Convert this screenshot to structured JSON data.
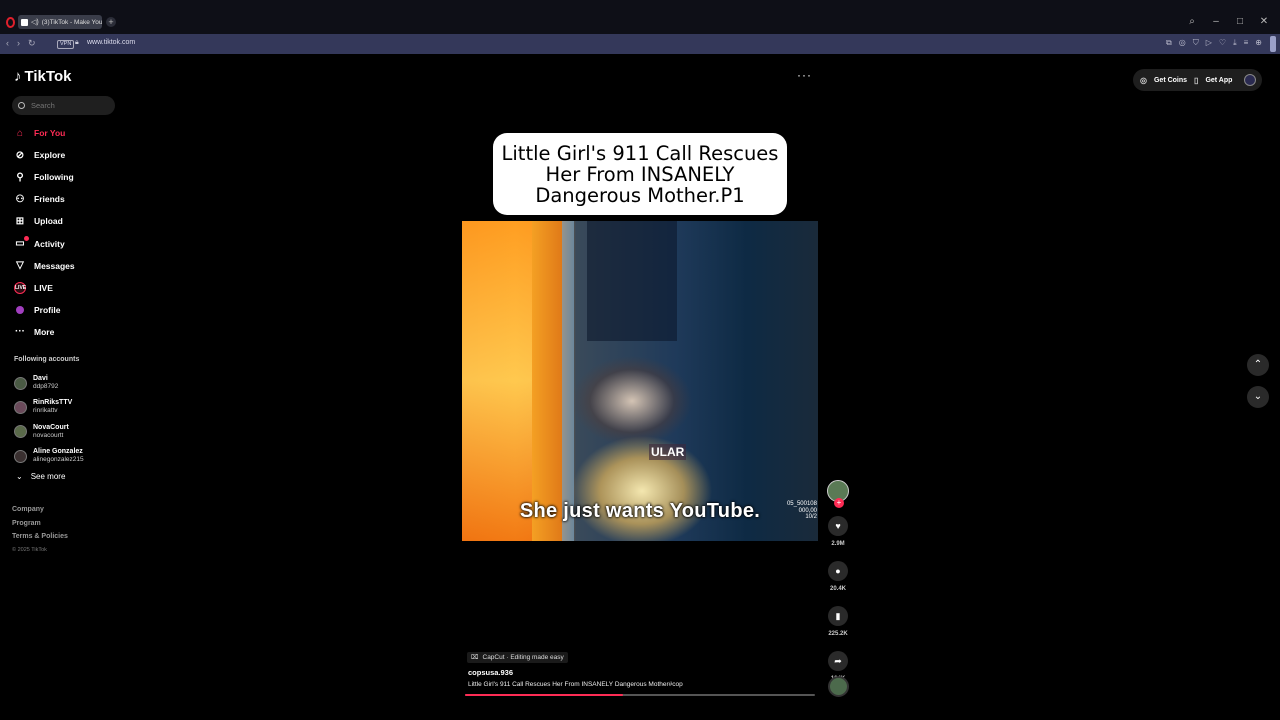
{
  "browser": {
    "tab_title": "(3)TikTok - Make Your",
    "url": "www.tiktok.com",
    "vpn_label": "VPN"
  },
  "sidebar": {
    "logo": "TikTok",
    "search_placeholder": "Search",
    "nav": [
      {
        "label": "For You",
        "icon": "home-icon"
      },
      {
        "label": "Explore",
        "icon": "compass-icon"
      },
      {
        "label": "Following",
        "icon": "following-icon"
      },
      {
        "label": "Friends",
        "icon": "friends-icon"
      },
      {
        "label": "Upload",
        "icon": "upload-icon"
      },
      {
        "label": "Activity",
        "icon": "activity-icon"
      },
      {
        "label": "Messages",
        "icon": "messages-icon"
      },
      {
        "label": "LIVE",
        "icon": "live-icon"
      },
      {
        "label": "Profile",
        "icon": "profile-icon"
      },
      {
        "label": "More",
        "icon": "more-icon"
      }
    ],
    "following_title": "Following accounts",
    "accounts": [
      {
        "name": "Davi",
        "handle": "ddp8792"
      },
      {
        "name": "RinRiksTTV",
        "handle": "rinrikattv"
      },
      {
        "name": "NovaCourt",
        "handle": "novacourtt"
      },
      {
        "name": "Aline Gonzalez",
        "handle": "alinegonzalez215"
      }
    ],
    "see_more": "See more",
    "footer": {
      "company": "Company",
      "program": "Program",
      "terms": "Terms & Policies",
      "copyright": "© 2025 TikTok"
    }
  },
  "topbar": {
    "get_coins": "Get Coins",
    "get_app": "Get App"
  },
  "video": {
    "title_card": [
      "Little Girl's 911 Call Rescues",
      "Her From INSANELY",
      "Dangerous Mother.P1"
    ],
    "overlay_text": "She just wants YouTube.",
    "tag_text": "ULAR",
    "stamp": [
      "05_500108",
      "000,00",
      "10/2"
    ],
    "capcut": "CapCut · Editing made easy",
    "author": "copsusa.936",
    "description": "Little Girl's 911 Call Rescues Her From INSANELY Dangerous Mother#cop",
    "progress": 0.45
  },
  "actions": {
    "likes": "2.9M",
    "comments": "20.4K",
    "saves": "225.2K",
    "shares": "104K"
  },
  "colors": {
    "accent": "#fe2c55"
  }
}
